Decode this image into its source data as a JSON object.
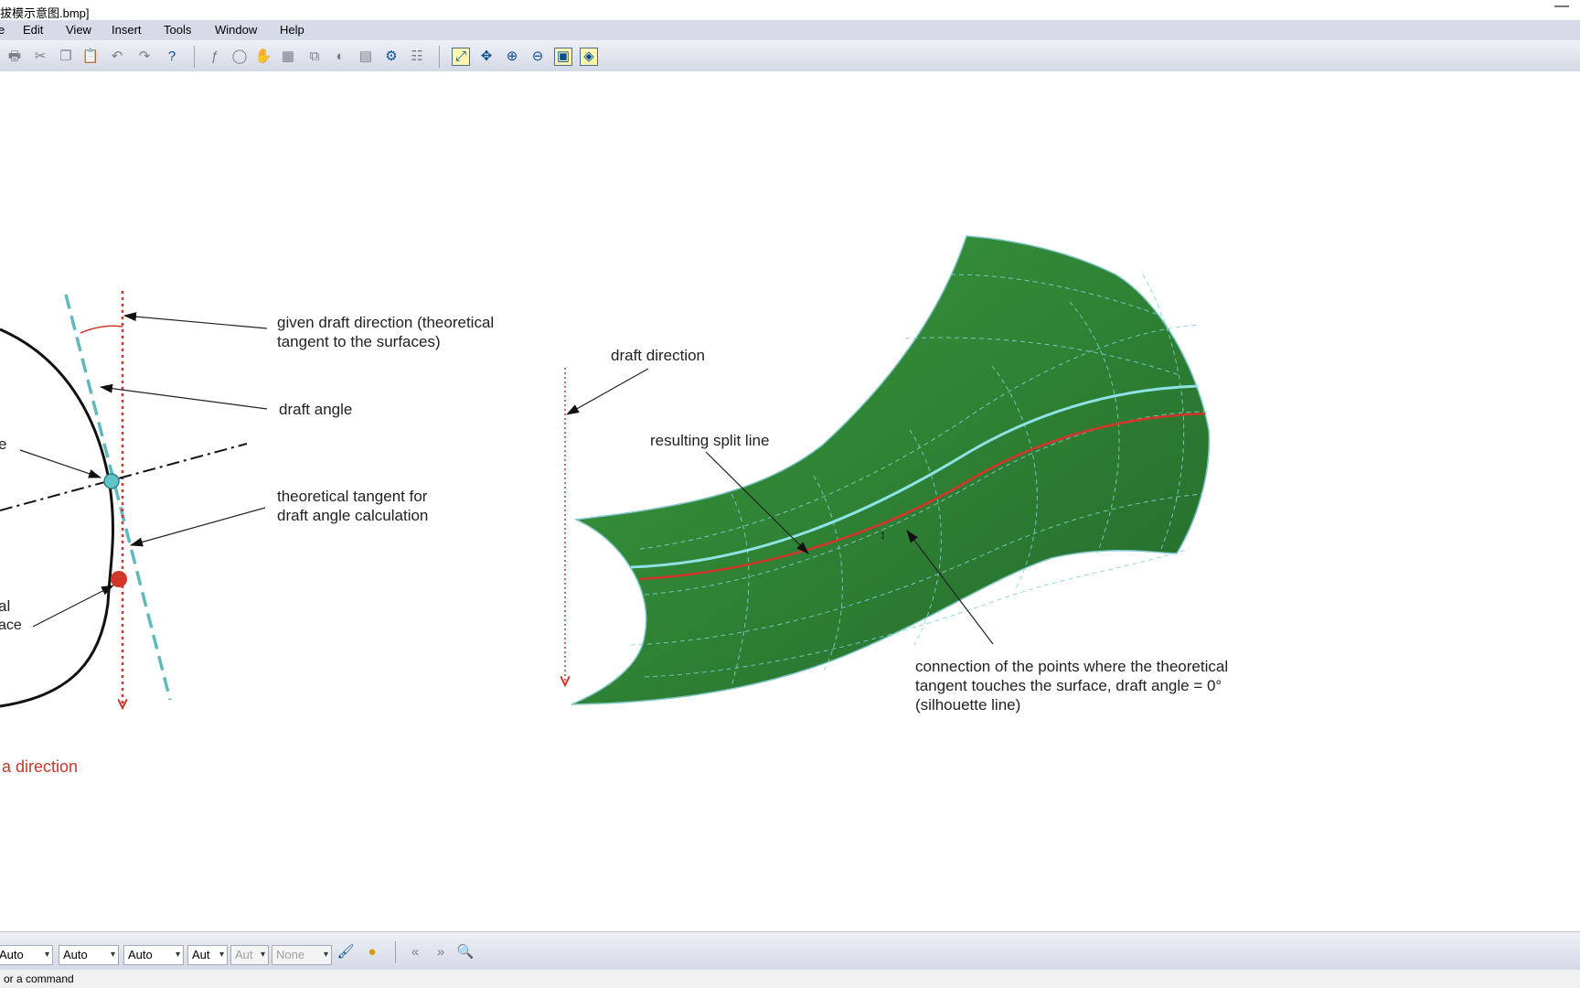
{
  "window": {
    "title": "拔模示意图.bmp]",
    "minimize_glyph": "—"
  },
  "menu": [
    "Edit",
    "View",
    "Insert",
    "Tools",
    "Window",
    "Help"
  ],
  "toolbar_icons": [
    "print-icon",
    "cut-icon",
    "copy-icon",
    "paste-icon",
    "undo-icon",
    "redo-icon",
    "whats-this-icon",
    "formula-icon",
    "comment-icon",
    "hand-icon",
    "table-icon",
    "tree-icon",
    "shade-icon",
    "graph-icon",
    "tools-icon",
    "hierarchy-icon",
    "fit-all-icon",
    "pan-icon",
    "zoom-in-icon",
    "zoom-out-icon",
    "normal-view-icon",
    "view-mode-icon"
  ],
  "diagram": {
    "left": {
      "label_draft_direction": [
        "given draft direction (theoretical",
        "tangent to the surfaces)"
      ],
      "label_draft_angle": "draft angle",
      "label_tangent": [
        "theoretical tangent for",
        "draft angle calculation"
      ],
      "cut_label_1": "e",
      "cut_label_2a": "al",
      "cut_label_2b": "ace",
      "caption": "a direction"
    },
    "right": {
      "label_draft_direction": "draft direction",
      "label_split_line": "resulting split line",
      "label_connection": [
        "connection of the points where the theoretical",
        "tangent touches the surface, draft angle = 0°",
        "(silhouette line)"
      ]
    },
    "colors": {
      "surface": "#2f7d34",
      "red": "#d2352a",
      "cyan": "#5fc3c7",
      "arrow": "#111111"
    }
  },
  "bottom_toolbar": {
    "combos": [
      "Auto",
      "Auto",
      "Auto",
      "Aut",
      "Aut",
      "None"
    ],
    "icons": [
      "format-painter-icon",
      "palette-icon",
      "first-page-icon",
      "last-page-icon",
      "search-icon"
    ]
  },
  "status": {
    "text": "or a command"
  }
}
